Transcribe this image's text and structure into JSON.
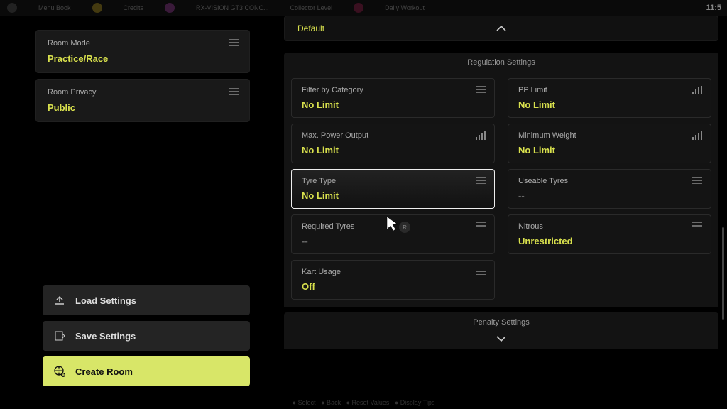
{
  "topbar": {
    "menu_label": "Menu Book",
    "credits": "Credits",
    "car": "RX-VISION GT3 CONC...",
    "collector": "Collector Level",
    "daily": "Daily Workout",
    "time": "11:5"
  },
  "sidebar": {
    "room_mode": {
      "label": "Room Mode",
      "value": "Practice/Race"
    },
    "room_privacy": {
      "label": "Room Privacy",
      "value": "Public"
    },
    "load": "Load Settings",
    "save": "Save Settings",
    "create": "Create Room"
  },
  "top_collapse": {
    "label": "Default"
  },
  "regulation_title": "Regulation Settings",
  "reg": {
    "filter_category": {
      "label": "Filter by Category",
      "value": "No Limit"
    },
    "pp_limit": {
      "label": "PP Limit",
      "value": "No Limit"
    },
    "max_power": {
      "label": "Max. Power Output",
      "value": "No Limit"
    },
    "min_weight": {
      "label": "Minimum Weight",
      "value": "No Limit"
    },
    "tyre_type": {
      "label": "Tyre Type",
      "value": "No Limit"
    },
    "useable_tyres": {
      "label": "Useable Tyres",
      "value": "--"
    },
    "required_tyres": {
      "label": "Required Tyres",
      "value": "--"
    },
    "nitrous": {
      "label": "Nitrous",
      "value": "Unrestricted"
    },
    "kart_usage": {
      "label": "Kart Usage",
      "value": "Off"
    }
  },
  "penalty_title": "Penalty Settings",
  "cursor_badge": "R"
}
